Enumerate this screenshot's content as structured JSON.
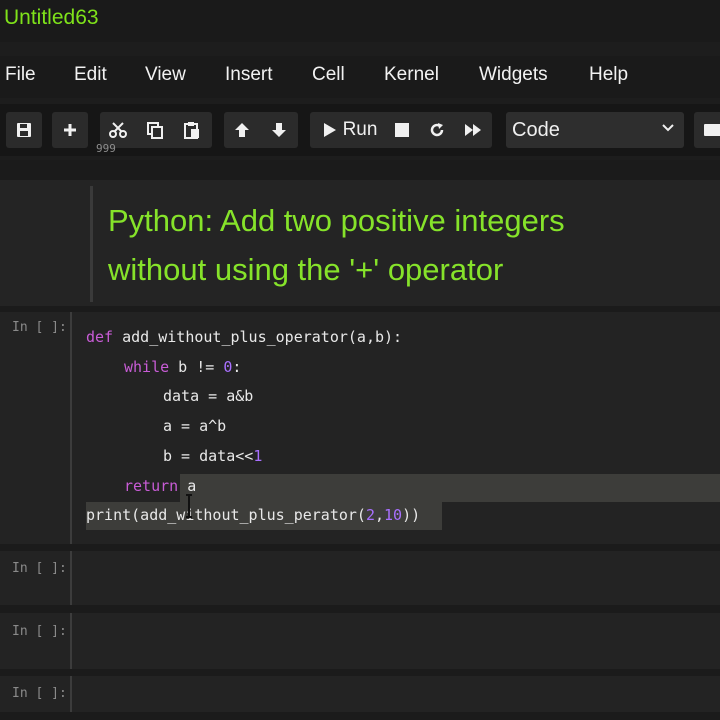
{
  "window": {
    "title": "Untitled63"
  },
  "menu": [
    "File",
    "Edit",
    "View",
    "Insert",
    "Cell",
    "Kernel",
    "Widgets",
    "Help"
  ],
  "toolbar": {
    "save_icon": "save-icon",
    "add_icon": "plus-icon",
    "run_label": "Run",
    "cell_type": "Code"
  },
  "previous_output": "999",
  "markdown_cell": {
    "line1": "Python: Add two positive integers",
    "line2": "without using the '+' operator"
  },
  "code_cell": {
    "prompt": "In [ ]:",
    "lines": [
      {
        "kw": "def",
        "rest": " add_without_plus_operator(a,b):"
      },
      {
        "kw": "while",
        "rest": " b != ",
        "num": "0",
        "tail": ":"
      },
      {
        "text": "data = a&b"
      },
      {
        "text": "a = a^b"
      },
      {
        "pre": "b = data<<",
        "num": "1"
      },
      {
        "kw": "return",
        "rest": " a"
      },
      {
        "pre": "print(add_without_plus_perator(",
        "num1": "2",
        "mid": ",",
        "num2": "10",
        "post": "))"
      }
    ]
  },
  "empty_cells": [
    {
      "prompt": "In [ ]:"
    },
    {
      "prompt": "In [ ]:"
    },
    {
      "prompt": "In [ ]:"
    }
  ],
  "colors": {
    "accent_green": "#86e32a",
    "keyword": "#c85cd6",
    "number": "#a970ff"
  }
}
